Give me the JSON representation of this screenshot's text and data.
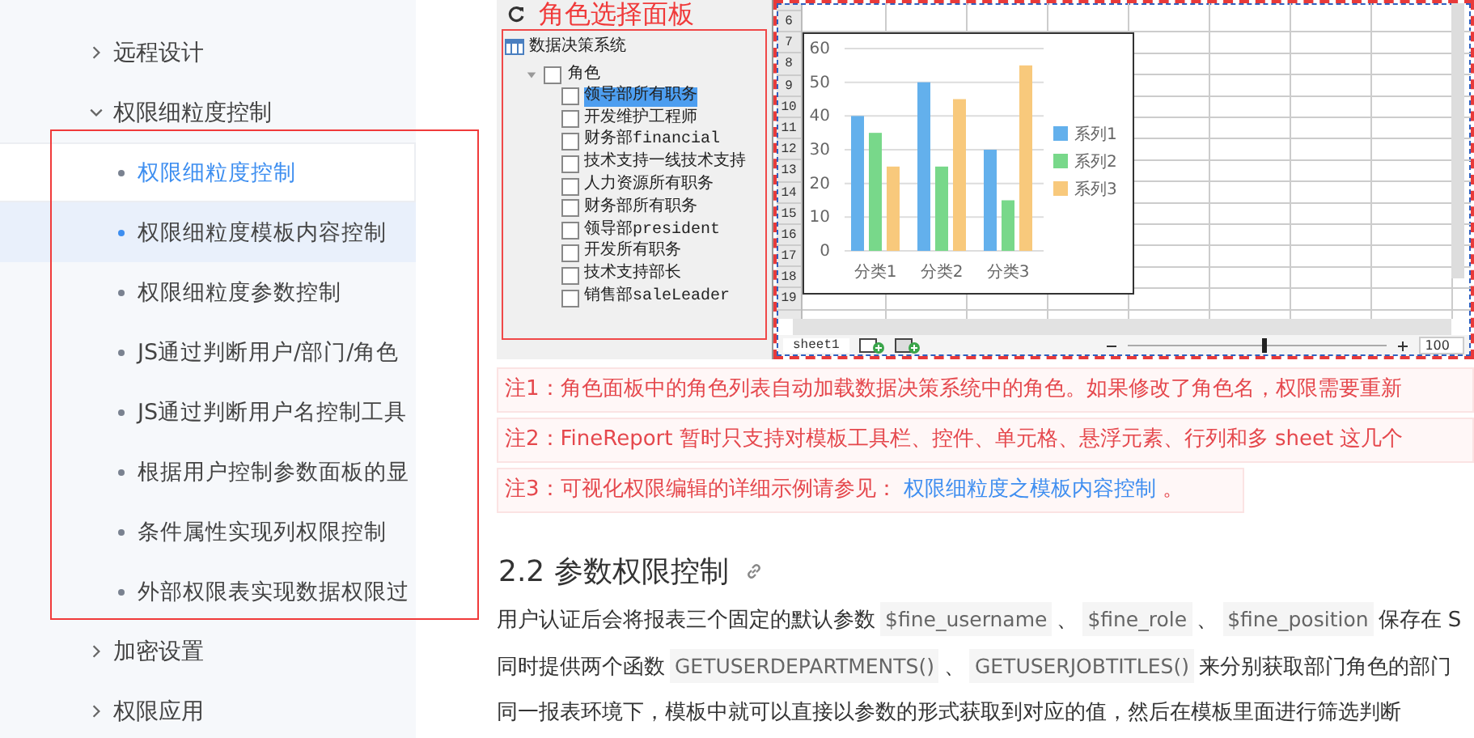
{
  "sidebar": {
    "items": [
      {
        "label": "远程设计",
        "expanded": false
      },
      {
        "label": "权限细粒度控制",
        "expanded": true,
        "children": [
          {
            "label": "权限细粒度控制",
            "selected": true,
            "hovered": false
          },
          {
            "label": "权限细粒度模板内容控制",
            "selected": false,
            "hovered": true
          },
          {
            "label": "权限细粒度参数控制",
            "selected": false,
            "hovered": false
          },
          {
            "label": "JS通过判断用户/部门/角色",
            "selected": false,
            "hovered": false
          },
          {
            "label": "JS通过判断用户名控制工具",
            "selected": false,
            "hovered": false
          },
          {
            "label": "根据用户控制参数面板的显",
            "selected": false,
            "hovered": false
          },
          {
            "label": "条件属性实现列权限控制",
            "selected": false,
            "hovered": false
          },
          {
            "label": "外部权限表实现数据权限过",
            "selected": false,
            "hovered": false
          }
        ]
      },
      {
        "label": "加密设置",
        "expanded": false
      },
      {
        "label": "权限应用",
        "expanded": false
      }
    ]
  },
  "screenshot": {
    "role_panel": {
      "title": "角色选择面板",
      "root": "数据决策系统",
      "groups": [
        {
          "label": "角色",
          "expanded": true,
          "checked": false,
          "children": [
            {
              "label": "领导部所有职务",
              "checked": false,
              "selected": true
            },
            {
              "label": "开发维护工程师",
              "checked": false,
              "selected": false
            },
            {
              "label": "财务部financial",
              "checked": false,
              "selected": false
            },
            {
              "label": "技术支持一线技术支持",
              "checked": false,
              "selected": false
            },
            {
              "label": "人力资源所有职务",
              "checked": false,
              "selected": false
            },
            {
              "label": "财务部所有职务",
              "checked": false,
              "selected": false
            },
            {
              "label": "领导部president",
              "checked": false,
              "selected": false
            },
            {
              "label": "开发所有职务",
              "checked": false,
              "selected": false
            },
            {
              "label": "技术支持部长",
              "checked": false,
              "selected": false
            },
            {
              "label": "销售部saleLeader",
              "checked": false,
              "selected": false
            }
          ]
        }
      ]
    },
    "spreadsheet": {
      "row_numbers": [
        "6",
        "7",
        "8",
        "9",
        "10",
        "11",
        "12",
        "13",
        "14",
        "15",
        "16",
        "17",
        "18",
        "19"
      ],
      "chart_data": {
        "type": "bar",
        "grid": true,
        "legend": true,
        "categories": [
          "分类1",
          "分类2",
          "分类3"
        ],
        "ylim": [
          0,
          60
        ],
        "yticks": [
          0,
          10,
          20,
          30,
          40,
          50,
          60
        ],
        "series": [
          {
            "name": "系列1",
            "color": "#63b0ec",
            "values": [
              40,
              50,
              30
            ]
          },
          {
            "name": "系列2",
            "color": "#78d88a",
            "values": [
              35,
              25,
              15
            ]
          },
          {
            "name": "系列3",
            "color": "#f8c97c",
            "values": [
              25,
              45,
              55
            ]
          }
        ]
      },
      "sheet_tab": "sheet1",
      "zoom_slider": {
        "level": 0.52
      },
      "zoom_value": "100"
    }
  },
  "notes": [
    [
      {
        "kind": "text",
        "text": "注1：角色面板中的角色列表自动加载数据决策系统中的角色。如果修改了角色名，权限需要重新"
      }
    ],
    [
      {
        "kind": "text",
        "text": "注2：FineReport 暂时只支持对模板工具栏、控件、单元格、悬浮元素、行列和多 sheet 这几个"
      }
    ],
    [
      {
        "kind": "text",
        "text": "注3：可视化权限编辑的详细示例请参见： "
      },
      {
        "kind": "link",
        "text": "权限细粒度之模板内容控制"
      },
      {
        "kind": "text",
        "text": " 。"
      }
    ]
  ],
  "section": {
    "heading": "2.2 参数权限控制",
    "paragraphs": [
      [
        {
          "kind": "text",
          "text": "用户认证后会将报表三个固定的默认参数"
        },
        {
          "kind": "code",
          "text": "$fine_username"
        },
        {
          "kind": "text",
          "text": "、"
        },
        {
          "kind": "code",
          "text": "$fine_role"
        },
        {
          "kind": "text",
          "text": "、"
        },
        {
          "kind": "code",
          "text": "$fine_position"
        },
        {
          "kind": "text",
          "text": "保存在 S"
        }
      ],
      [
        {
          "kind": "text",
          "text": "同时提供两个函数"
        },
        {
          "kind": "code",
          "text": "GETUSERDEPARTMENTS()"
        },
        {
          "kind": "text",
          "text": "、"
        },
        {
          "kind": "code",
          "text": "GETUSERJOBTITLES()"
        },
        {
          "kind": "text",
          "text": "来分别获取部门角色的部门"
        }
      ],
      [
        {
          "kind": "text",
          "text": "同一报表环境下，模板中就可以直接以参数的形式获取到对应的值，然后在模板里面进行筛选判断"
        }
      ]
    ]
  }
}
